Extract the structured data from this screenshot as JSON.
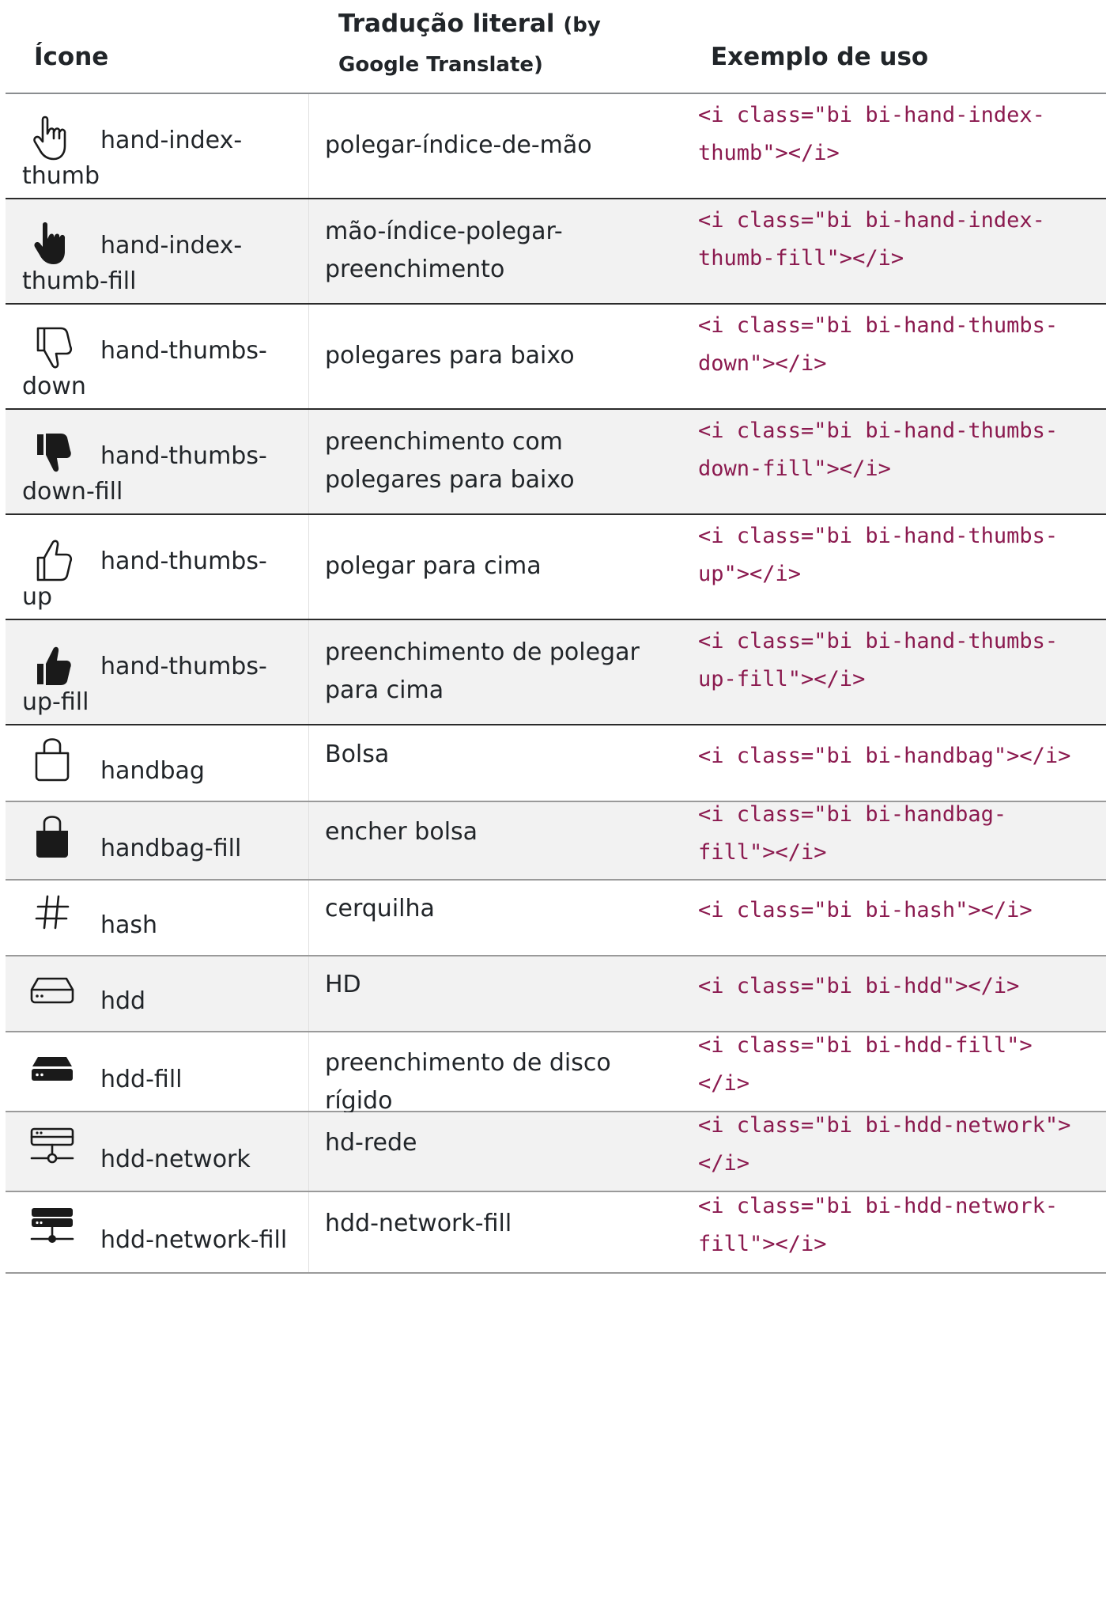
{
  "header": {
    "icon_col": "Ícone",
    "translation_col": "Tradução literal",
    "translation_col_note": "(by Google Translate)",
    "example_col": "Exemplo de uso"
  },
  "rows": [
    {
      "icon": "hand-index-thumb-icon",
      "name_a": "hand-index-",
      "name_b": "thumb",
      "translation": [
        "polegar-índice-de-mão"
      ],
      "code": [
        "<i class=\"bi bi-hand-index-",
        "thumb\"></i>"
      ]
    },
    {
      "icon": "hand-index-thumb-fill-icon",
      "name_a": "hand-index-",
      "name_b": "thumb-fill",
      "translation": [
        "mão-índice-polegar-",
        "preenchimento"
      ],
      "code": [
        "<i class=\"bi bi-hand-index-",
        "thumb-fill\"></i>"
      ]
    },
    {
      "icon": "hand-thumbs-down-icon",
      "name_a": "hand-thumbs-",
      "name_b": "down",
      "translation": [
        "polegares para baixo"
      ],
      "code": [
        "<i class=\"bi bi-hand-thumbs-",
        "down\"></i>"
      ]
    },
    {
      "icon": "hand-thumbs-down-fill-icon",
      "name_a": "hand-thumbs-",
      "name_b": "down-fill",
      "translation": [
        "preenchimento com",
        "polegares para baixo"
      ],
      "code": [
        "<i class=\"bi bi-hand-thumbs-",
        "down-fill\"></i>"
      ]
    },
    {
      "icon": "hand-thumbs-up-icon",
      "name_a": "hand-thumbs-",
      "name_b": "up",
      "translation": [
        "polegar para cima"
      ],
      "code": [
        "<i class=\"bi bi-hand-thumbs-",
        "up\"></i>"
      ]
    },
    {
      "icon": "hand-thumbs-up-fill-icon",
      "name_a": "hand-thumbs-",
      "name_b": "up-fill",
      "translation": [
        "preenchimento de polegar",
        "para cima"
      ],
      "code": [
        "<i class=\"bi bi-hand-thumbs-",
        "up-fill\"></i>"
      ]
    },
    {
      "icon": "handbag-icon",
      "name_a": "handbag",
      "name_b": "",
      "translation": [
        "Bolsa"
      ],
      "code": [
        "<i class=\"bi bi-handbag\"></i>"
      ]
    },
    {
      "icon": "handbag-fill-icon",
      "name_a": "handbag-fill",
      "name_b": "",
      "translation": [
        "encher bolsa"
      ],
      "code": [
        "<i class=\"bi bi-handbag-",
        "fill\"></i>"
      ]
    },
    {
      "icon": "hash-icon",
      "name_a": "hash",
      "name_b": "",
      "translation": [
        "cerquilha"
      ],
      "code": [
        "<i class=\"bi bi-hash\"></i>"
      ]
    },
    {
      "icon": "hdd-icon",
      "name_a": "hdd",
      "name_b": "",
      "translation": [
        "HD"
      ],
      "code": [
        "<i class=\"bi bi-hdd\"></i>"
      ]
    },
    {
      "icon": "hdd-fill-icon",
      "name_a": "hdd-fill",
      "name_b": "",
      "translation": [
        "preenchimento de disco",
        "rígido"
      ],
      "code": [
        "<i class=\"bi bi-hdd-fill\">",
        "</i>"
      ]
    },
    {
      "icon": "hdd-network-icon",
      "name_a": "hdd-network",
      "name_b": "",
      "translation": [
        "hd-rede"
      ],
      "code": [
        "<i class=\"bi bi-hdd-network\">",
        "</i>"
      ]
    },
    {
      "icon": "hdd-network-fill-icon",
      "name_a": "hdd-network-fill",
      "name_b": "",
      "translation": [
        "hdd-network-fill"
      ],
      "code": [
        "<i class=\"bi bi-hdd-network-",
        "fill\"></i>"
      ]
    }
  ]
}
